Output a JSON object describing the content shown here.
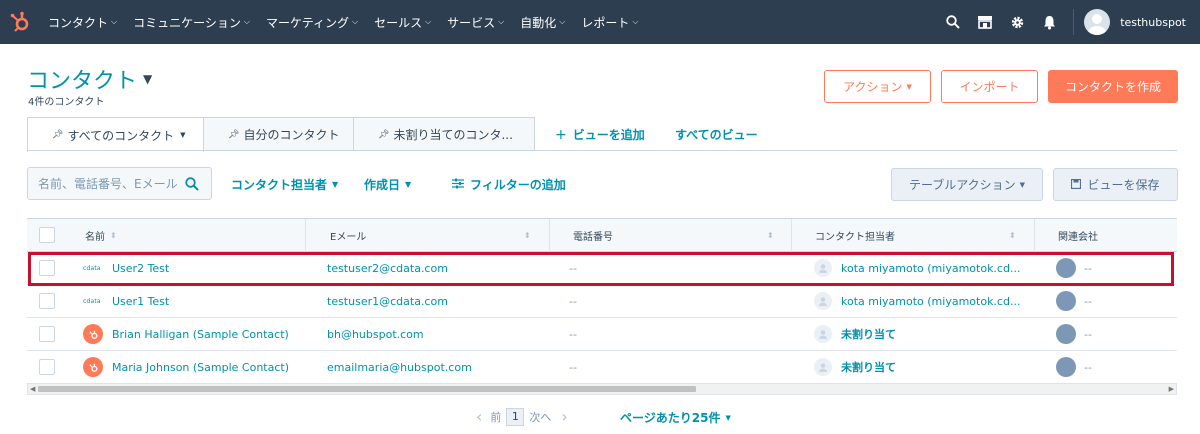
{
  "nav": {
    "items": [
      {
        "label": "コンタクト"
      },
      {
        "label": "コミュニケーション"
      },
      {
        "label": "マーケティング"
      },
      {
        "label": "セールス"
      },
      {
        "label": "サービス"
      },
      {
        "label": "自動化"
      },
      {
        "label": "レポート"
      }
    ],
    "account": "testhubspot"
  },
  "header": {
    "title": "コンタクト",
    "subtitle": "4件のコンタクト",
    "actions_label": "アクション",
    "import_label": "インポート",
    "create_label": "コンタクトを作成"
  },
  "tabs": {
    "items": [
      {
        "label": "すべてのコンタクト"
      },
      {
        "label": "自分のコンタクト"
      },
      {
        "label": "未割り当てのコンタ..."
      }
    ],
    "add_view": "ビューを追加",
    "all_views": "すべてのビュー"
  },
  "filters": {
    "search_placeholder": "名前、電話番号、Eメール",
    "owner": "コンタクト担当者",
    "created": "作成日",
    "add_filter": "フィルターの追加",
    "table_actions": "テーブルアクション",
    "save_view": "ビューを保存"
  },
  "table": {
    "columns": [
      "名前",
      "Eメール",
      "電話番号",
      "コンタクト担当者",
      "関連会社"
    ],
    "rows": [
      {
        "avatar": "cdata-logo",
        "name": "User2 Test",
        "email": "testuser2@cdata.com",
        "phone": "--",
        "owner": "kota miyamoto (miyamotok.cd...",
        "company": "--"
      },
      {
        "avatar": "cdata-logo",
        "name": "User1 Test",
        "email": "testuser1@cdata.com",
        "phone": "--",
        "owner": "kota miyamoto (miyamotok.cd...",
        "company": "--"
      },
      {
        "avatar": "hubspot-sprocket-icon",
        "name": "Brian Halligan (Sample Contact)",
        "email": "bh@hubspot.com",
        "phone": "--",
        "owner": "未割り当て",
        "company": "--"
      },
      {
        "avatar": "hubspot-sprocket-icon",
        "name": "Maria Johnson (Sample Contact)",
        "email": "emailmaria@hubspot.com",
        "phone": "--",
        "owner": "未割り当て",
        "company": "--"
      }
    ],
    "logo_text": "cdata"
  },
  "pagination": {
    "prev": "前",
    "page": "1",
    "next": "次へ",
    "per_page": "ページあたり25件"
  },
  "colors": {
    "nav_bg": "#2d3e50",
    "accent": "#ff7a59",
    "link": "#0091ae",
    "highlight": "#c8102e"
  }
}
